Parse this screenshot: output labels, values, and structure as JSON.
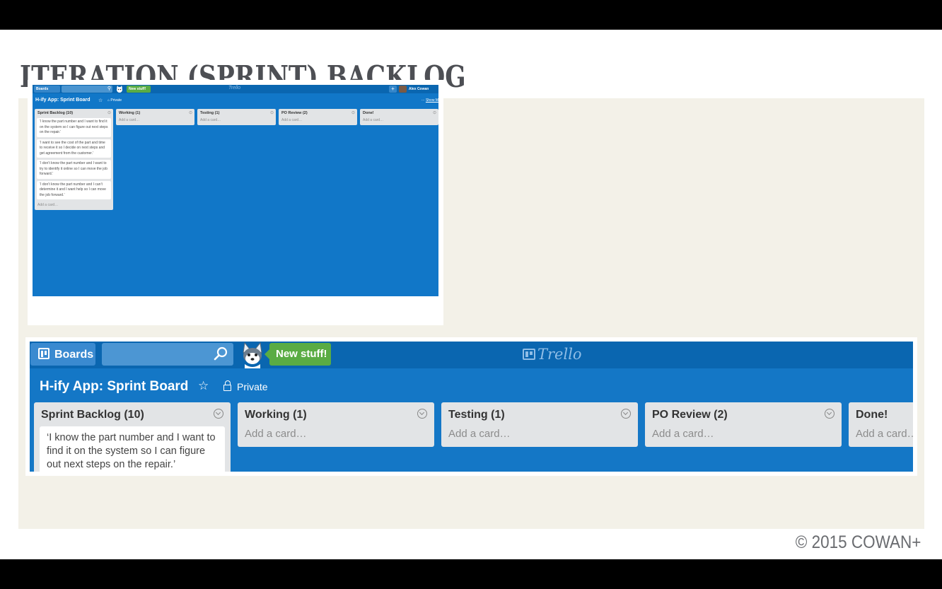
{
  "slide": {
    "title": "ITERATION (SPRINT) BACKLOG",
    "copyright": "© 2015 COWAN+"
  },
  "trello": {
    "boards_label": "Boards",
    "new_stuff_label": "New stuff!",
    "logo_text": "Trello",
    "add_icon": "+",
    "user_name": "Alex Cowan",
    "board_name": "H-ify App: Sprint Board",
    "visibility": "Private",
    "show_menu": "Show M",
    "add_card_label": "Add a card…",
    "lists": [
      {
        "title": "Sprint Backlog (10)",
        "cards": [
          "‘I know the part number and I want to find it on the system so I can figure out next steps on the repair.’",
          "‘I want to see the cost of the part and time to receive it so I decide on next steps and get agreement from the customer.’",
          "‘I don’t know the part number and I want to try to identify it online so I can move the job forward.’",
          "‘I don’t know the part number and I can’t determine it and I want help so I can move the job forward.’"
        ]
      },
      {
        "title": "Working (1)",
        "cards": []
      },
      {
        "title": "Testing (1)",
        "cards": []
      },
      {
        "title": "PO Review (2)",
        "cards": []
      },
      {
        "title": "Done!",
        "cards": []
      }
    ],
    "big_add_card_truncated": "Add a card…"
  },
  "icons": {
    "boards": "boards-icon",
    "search": "search-icon",
    "mascot": "husky-mascot-icon",
    "star": "star-icon",
    "lock": "lock-icon",
    "list_menu": "chevron-circle-icon"
  },
  "colors": {
    "board_bg": "#1477c6",
    "topbar": "#0a66b0",
    "new_stuff": "#5aac44",
    "list_bg": "#e2e4e6",
    "slide_panel": "#f3f1e8",
    "title": "#4d4f54"
  }
}
